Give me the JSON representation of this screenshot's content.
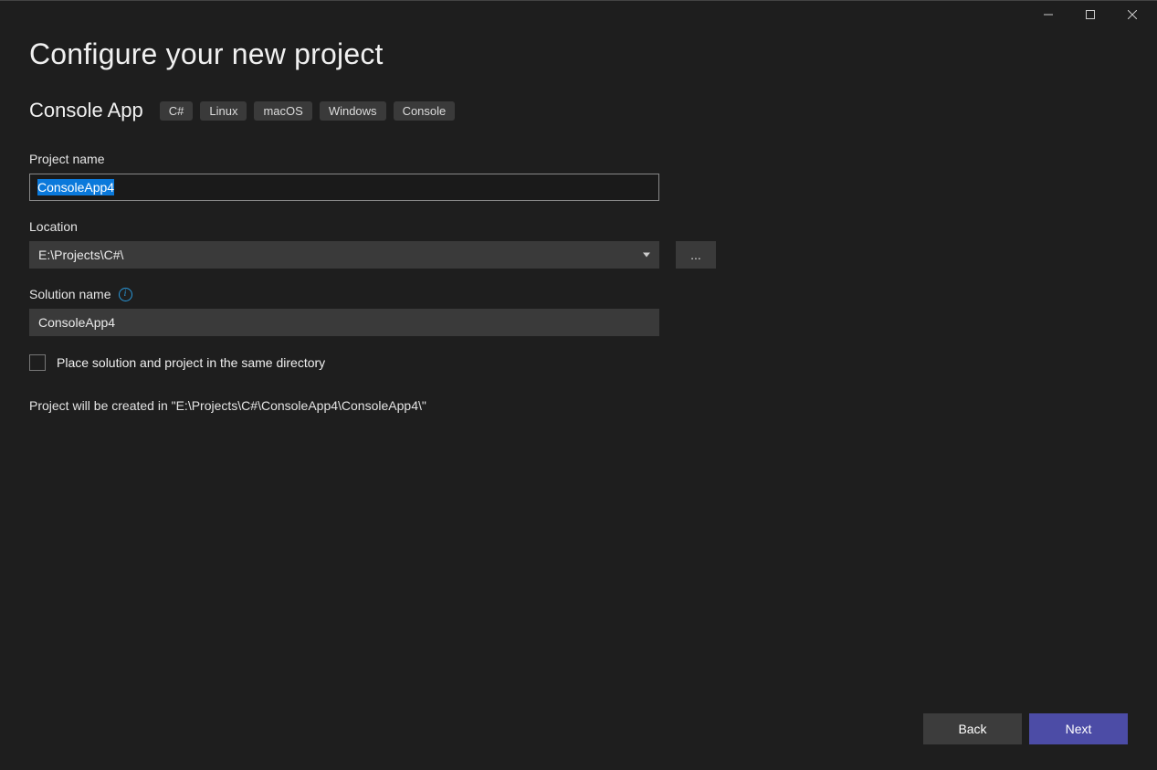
{
  "header": {
    "title": "Configure your new project"
  },
  "subheader": {
    "template_name": "Console App",
    "tags": [
      "C#",
      "Linux",
      "macOS",
      "Windows",
      "Console"
    ]
  },
  "fields": {
    "project_name": {
      "label": "Project name",
      "value": "ConsoleApp4"
    },
    "location": {
      "label": "Location",
      "value": "E:\\Projects\\C#\\",
      "browse_label": "..."
    },
    "solution_name": {
      "label": "Solution name",
      "value": "ConsoleApp4"
    },
    "same_directory": {
      "label": "Place solution and project in the same directory",
      "checked": false
    }
  },
  "path_note": "Project will be created in \"E:\\Projects\\C#\\ConsoleApp4\\ConsoleApp4\\\"",
  "footer": {
    "back_label": "Back",
    "next_label": "Next"
  }
}
